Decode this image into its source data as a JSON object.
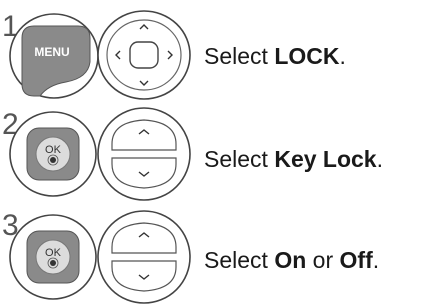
{
  "steps": [
    {
      "number": "1",
      "buttons": {
        "left": "menu-button",
        "left_label": "MENU",
        "right": "navigation-pad"
      },
      "instruction": {
        "prefix": "Select ",
        "emphasis": "LOCK",
        "suffix": "."
      }
    },
    {
      "number": "2",
      "buttons": {
        "left": "ok-button",
        "left_label": "OK",
        "right": "up-down-buttons"
      },
      "instruction": {
        "prefix": "Select ",
        "emphasis": "Key Lock",
        "suffix": "."
      }
    },
    {
      "number": "3",
      "buttons": {
        "left": "ok-button",
        "left_label": "OK",
        "right": "up-down-buttons"
      },
      "instruction": {
        "prefix": "Select ",
        "emphasis": "On",
        "middle": " or ",
        "emphasis2": "Off",
        "suffix": "."
      }
    }
  ],
  "colors": {
    "button_fill": "#8a8a8a",
    "button_outline": "#444444",
    "menu_text": "#ffffff",
    "text": "#1a1a1a"
  }
}
